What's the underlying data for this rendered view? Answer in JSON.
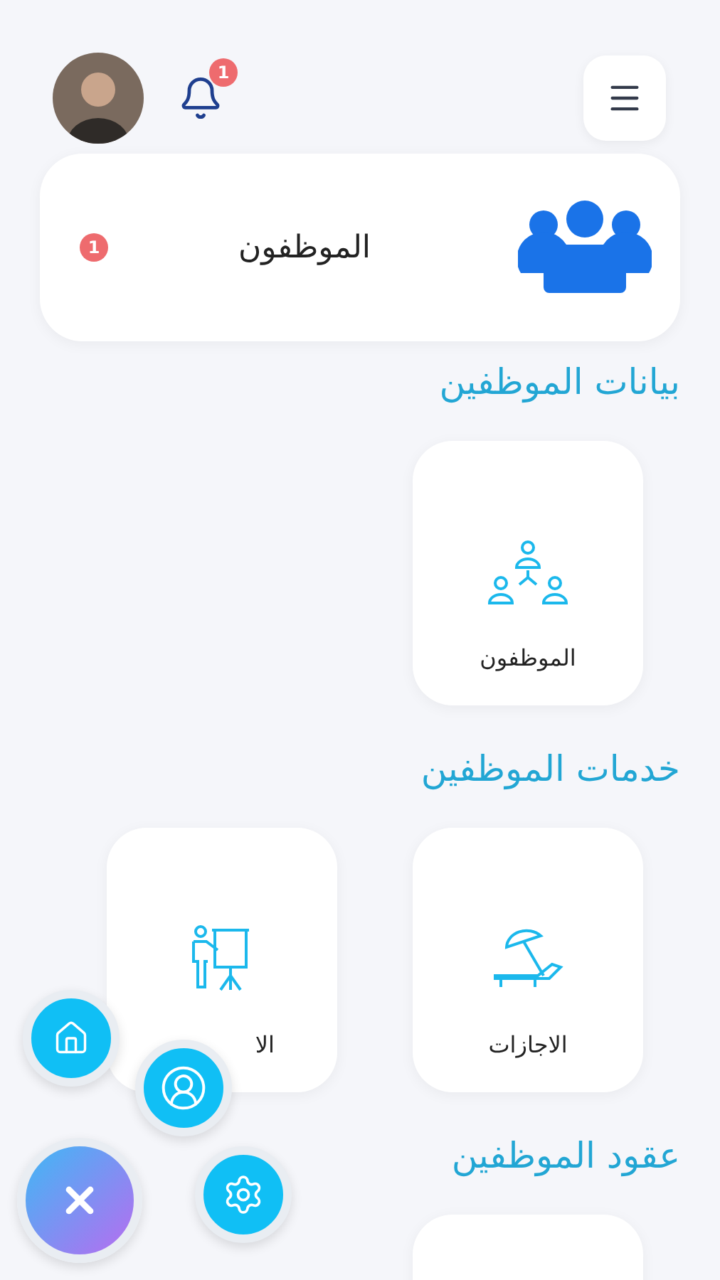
{
  "header": {
    "notification_count": "1"
  },
  "summary_card": {
    "title": "الموظفون",
    "badge": "1"
  },
  "sections": [
    {
      "title": "بيانات الموظفين",
      "items": [
        {
          "kind": "org",
          "label": "الموظفون"
        }
      ]
    },
    {
      "title": "خدمات الموظفين",
      "items": [
        {
          "kind": "vacation",
          "label": "الاجازات"
        },
        {
          "kind": "training",
          "label": "الا"
        }
      ]
    },
    {
      "title": "عقود الموظفين",
      "items": [
        {
          "kind": "blank"
        }
      ]
    }
  ],
  "fab_menu": {
    "expanded": true,
    "actions": [
      {
        "kind": "home"
      },
      {
        "kind": "profile"
      },
      {
        "kind": "settings"
      }
    ]
  }
}
